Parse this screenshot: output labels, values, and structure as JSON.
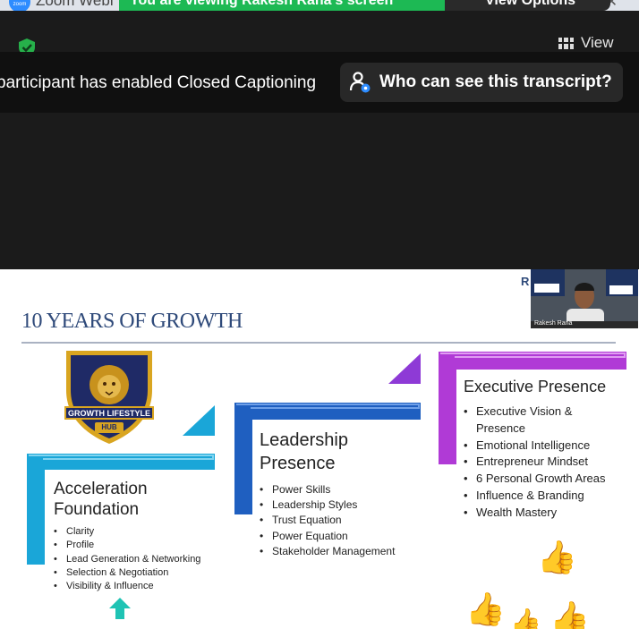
{
  "window": {
    "app_title": "Zoom Webi",
    "share_banner": "You are viewing Rakesh Rana's screen",
    "view_options": "View Options",
    "view_label": "View"
  },
  "captions": {
    "notice": "participant has enabled Closed Captioning",
    "transcript_button": "Who can see this transcript?"
  },
  "slide": {
    "title": "10 YEARS OF GROWTH",
    "badge": {
      "line1": "GROWTH LIFESTYLE",
      "line2": "HUB"
    },
    "presenter_name": "Rakesh Rana",
    "presenter_tag": "R",
    "steps": [
      {
        "title_line1": "Acceleration",
        "title_line2": "Foundation",
        "color": "#1aa6d8",
        "items": [
          "Clarity",
          "Profile",
          "Lead Generation & Networking",
          "Selection & Negotiation",
          "Visibility & Influence"
        ]
      },
      {
        "title_line1": "Leadership",
        "title_line2": "Presence",
        "color": "#1f5fc0",
        "items": [
          "Power Skills",
          "Leadership Styles",
          "Trust Equation",
          "Power Equation",
          "Stakeholder Management"
        ]
      },
      {
        "title_line1": "Executive Presence",
        "title_line2": "",
        "color": "#b03ad6",
        "items": [
          "Executive Vision & Presence",
          "Emotional Intelligence",
          "Entrepreneur Mindset",
          "6 Personal Growth Areas",
          "Influence & Branding",
          "Wealth Mastery"
        ]
      }
    ]
  },
  "colors": {
    "banner_green": "#1db954",
    "caption_bg": "#101010",
    "title_blue": "#2f4a7a",
    "arrow_teal": "#1fc3b4"
  },
  "icons": [
    "zoom-logo-icon",
    "shield-check-icon",
    "grid-view-icon",
    "transcript-person-icon",
    "thumbs-up-icon",
    "arrow-up-icon",
    "lion-crest-icon"
  ]
}
